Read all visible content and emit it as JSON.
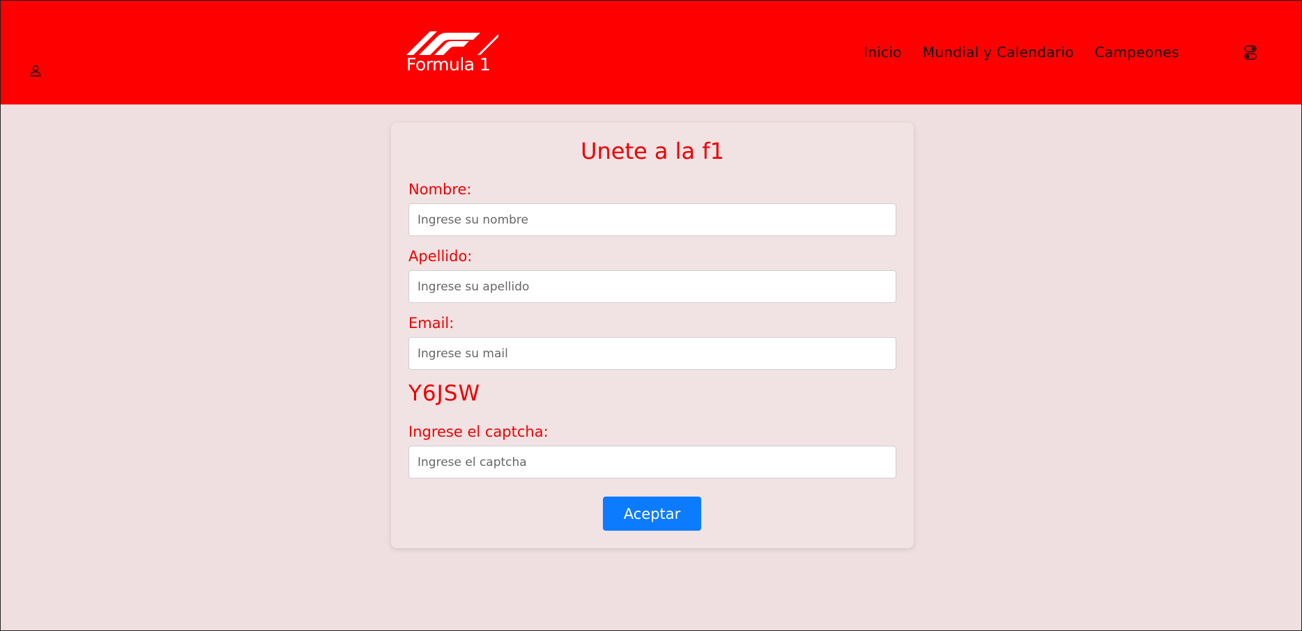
{
  "header": {
    "logo_text": "Formula 1",
    "nav": [
      {
        "label": "Inicio"
      },
      {
        "label": "Mundial y Calendario"
      },
      {
        "label": "Campeones"
      }
    ],
    "colors": {
      "background": "#ff0000",
      "logo": "#ffffff"
    },
    "icons": {
      "user": "user-icon",
      "theme": "toggle-icon"
    }
  },
  "form": {
    "title": "Unete a la f1",
    "fields": {
      "nombre": {
        "label": "Nombre:",
        "placeholder": "Ingrese su nombre",
        "value": ""
      },
      "apellido": {
        "label": "Apellido:",
        "placeholder": "Ingrese su apellido",
        "value": ""
      },
      "email": {
        "label": "Email:",
        "placeholder": "Ingrese su mail",
        "value": ""
      },
      "captcha": {
        "label": "Ingrese el captcha:",
        "placeholder": "Ingrese el captcha",
        "value": ""
      }
    },
    "captcha_code": "Y6JSW",
    "submit_label": "Aceptar",
    "colors": {
      "label": "#ee0000",
      "button": "#0d7bff",
      "page_background": "#efdfe0"
    }
  }
}
